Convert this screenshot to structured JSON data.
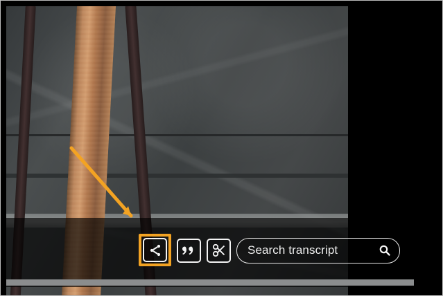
{
  "player": {
    "search": {
      "placeholder": "Search transcript"
    },
    "icons": {
      "share": "share-icon",
      "quote": "quote-icon",
      "clip": "scissors-icon",
      "search": "search-icon"
    },
    "colors": {
      "highlight": "#f3a323",
      "controls": "#f4f4f4",
      "progress": "#8b8d8e"
    }
  }
}
